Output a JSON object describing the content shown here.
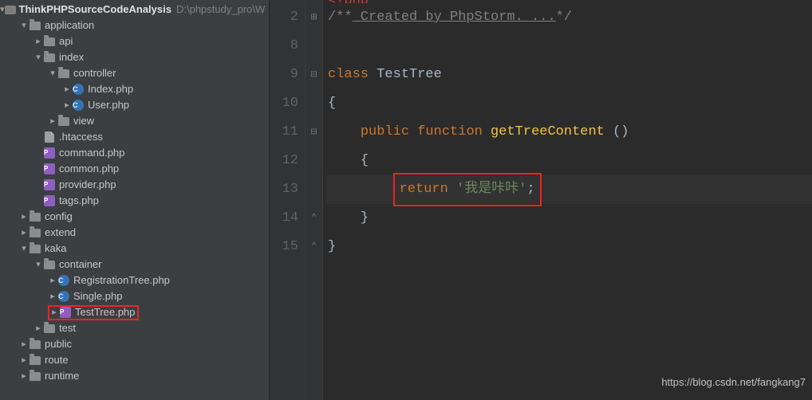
{
  "project": {
    "name": "ThinkPHPSourceCodeAnalysis",
    "path": "D:\\phpstudy_pro\\W"
  },
  "tree": [
    {
      "depth": 0,
      "exp": "exp",
      "icon": "root",
      "label": "ThinkPHPSourceCodeAnalysis",
      "root": true
    },
    {
      "depth": 1,
      "exp": "exp",
      "icon": "folder",
      "label": "application"
    },
    {
      "depth": 2,
      "exp": "col",
      "icon": "folder",
      "label": "api"
    },
    {
      "depth": 2,
      "exp": "exp",
      "icon": "folder",
      "label": "index"
    },
    {
      "depth": 3,
      "exp": "exp",
      "icon": "folder",
      "label": "controller"
    },
    {
      "depth": 4,
      "exp": "col",
      "icon": "phpc",
      "label": "Index.php"
    },
    {
      "depth": 4,
      "exp": "col",
      "icon": "phpc",
      "label": "User.php"
    },
    {
      "depth": 3,
      "exp": "col",
      "icon": "folder",
      "label": "view"
    },
    {
      "depth": 2,
      "exp": "none",
      "icon": "txt",
      "label": ".htaccess"
    },
    {
      "depth": 2,
      "exp": "none",
      "icon": "php",
      "label": "command.php"
    },
    {
      "depth": 2,
      "exp": "none",
      "icon": "php",
      "label": "common.php"
    },
    {
      "depth": 2,
      "exp": "none",
      "icon": "php",
      "label": "provider.php"
    },
    {
      "depth": 2,
      "exp": "none",
      "icon": "php",
      "label": "tags.php"
    },
    {
      "depth": 1,
      "exp": "col",
      "icon": "folder",
      "label": "config"
    },
    {
      "depth": 1,
      "exp": "col",
      "icon": "folder",
      "label": "extend"
    },
    {
      "depth": 1,
      "exp": "exp",
      "icon": "folder",
      "label": "kaka"
    },
    {
      "depth": 2,
      "exp": "exp",
      "icon": "folder",
      "label": "container"
    },
    {
      "depth": 3,
      "exp": "col",
      "icon": "phpc",
      "label": "RegistrationTree.php"
    },
    {
      "depth": 3,
      "exp": "col",
      "icon": "phpc",
      "label": "Single.php"
    },
    {
      "depth": 3,
      "exp": "col",
      "icon": "php",
      "label": "TestTree.php",
      "highlight": true
    },
    {
      "depth": 2,
      "exp": "col",
      "icon": "folder",
      "label": "test"
    },
    {
      "depth": 1,
      "exp": "col",
      "icon": "folder",
      "label": "public"
    },
    {
      "depth": 1,
      "exp": "col",
      "icon": "folder",
      "label": "route"
    },
    {
      "depth": 1,
      "exp": "col",
      "icon": "folder",
      "label": "runtime"
    }
  ],
  "editor": {
    "line_start": 2,
    "current_line": 13,
    "lines": {
      "1_partial": "<?php",
      "2_comment_open": "/**",
      "2_comment_text": " Created by PhpStorm. ...",
      "2_comment_close": "*/",
      "8": "",
      "9_kw": "class",
      "9_cls": " TestTree",
      "10": "{",
      "11_public": "public",
      "11_function": " function",
      "11_fn": " getTreeContent ",
      "11_paren": "()",
      "12": "{",
      "13_return": "return",
      "13_str": " '我是咔咔'",
      "13_semi": ";",
      "14": "}",
      "15": "}"
    },
    "gutter_marks": {
      "2": "⊞",
      "9": "⊟",
      "11": "⊟",
      "12": "",
      "14": "⌃",
      "15": "⌃"
    }
  },
  "watermark": "https://blog.csdn.net/fangkang7"
}
